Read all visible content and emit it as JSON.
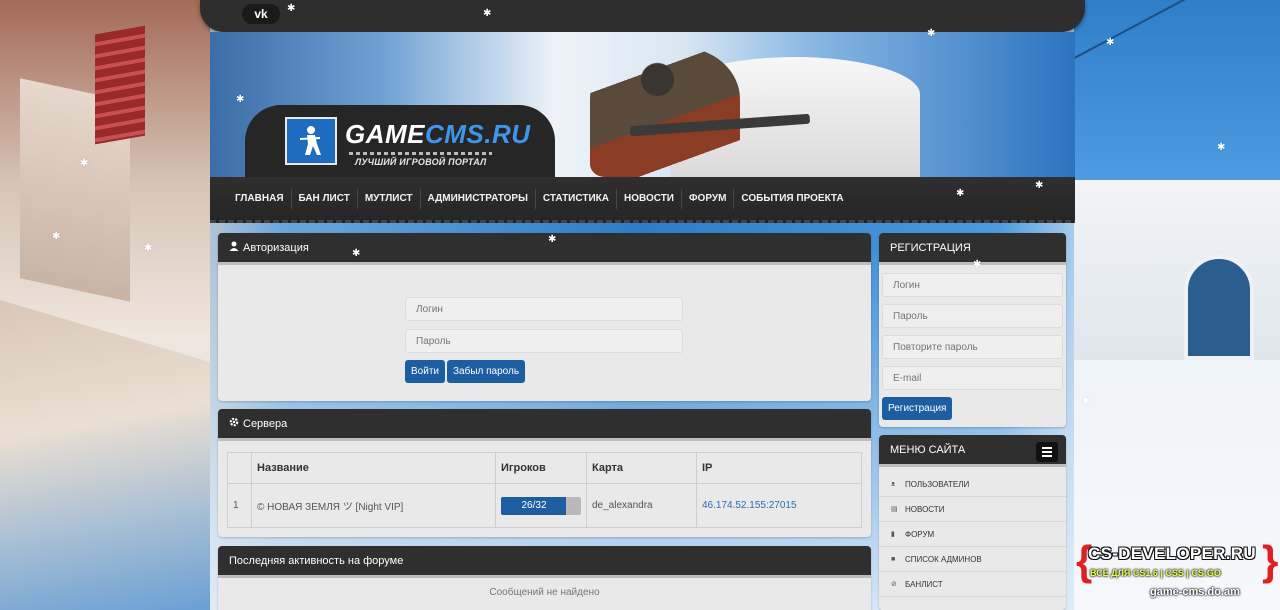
{
  "social": {
    "vk_label": "vk"
  },
  "logo": {
    "name_part1": "GAME",
    "name_part2": "CMS.RU",
    "tagline": "ЛУЧШИЙ ИГРОВОЙ ПОРТАЛ",
    "icon": "counter-strike-soldier-icon"
  },
  "nav": {
    "items": [
      "ГЛАВНАЯ",
      "БАН ЛИСТ",
      "МУТЛИСТ",
      "АДМИНИСТРАТОРЫ",
      "СТАТИСТИКА",
      "НОВОСТИ",
      "ФОРУМ",
      "СОБЫТИЯ ПРОЕКТА"
    ]
  },
  "auth": {
    "title": "Авторизация",
    "login_placeholder": "Логин",
    "password_placeholder": "Пароль",
    "login_button": "Войти",
    "forgot_button": "Забыл пароль"
  },
  "servers": {
    "title": "Сервера",
    "columns": [
      "Название",
      "Игроков",
      "Карта",
      "IP"
    ],
    "rows": [
      {
        "num": "1",
        "name": "© НОВАЯ ЗЕМЛЯ ツ [Night VIP]",
        "players": "26/32",
        "players_fraction": 0.8125,
        "map": "de_alexandra",
        "ip": "46.174.52.155:27015"
      }
    ]
  },
  "forum": {
    "title": "Последняя активность на форуме",
    "empty_text": "Сообщений не найдено"
  },
  "registration": {
    "title": "РЕГИСТРАЦИЯ",
    "login_placeholder": "Логин",
    "password_placeholder": "Пароль",
    "repeat_placeholder": "Повторите пароль",
    "email_placeholder": "E-mail",
    "submit_button": "Регистрация"
  },
  "site_menu": {
    "title": "МЕНЮ САЙТА",
    "items": [
      "ПОЛЬЗОВАТЕЛИ",
      "НОВОСТИ",
      "ФОРУМ",
      "СПИСОК АДМИНОВ",
      "БАНЛИСТ"
    ]
  },
  "watermark": {
    "title": "CS-DEVELOPER.RU",
    "subtitle": "ВСЕ ДЛЯ CS1.6 | CSS | CS:GO",
    "site": "game-cms.do.am"
  },
  "colors": {
    "accent": "#1d5ea3",
    "dark_panel": "#2f2f2f",
    "link": "#2c6cb5"
  }
}
